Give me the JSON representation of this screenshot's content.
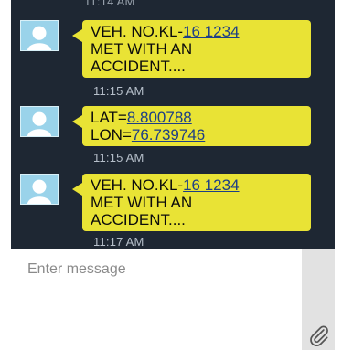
{
  "chat": {
    "top_time": "11:14 AM",
    "messages": [
      {
        "lines": [
          {
            "text": "VEH. NO.KL-",
            "link": "16 1234"
          },
          {
            "text": "MET WITH AN"
          },
          {
            "text": "ACCIDENT...."
          }
        ],
        "time": "11:15 AM"
      },
      {
        "lines": [
          {
            "text": "LAT=",
            "link": "8.800788"
          },
          {
            "text": "LON=",
            "link": "76.739746"
          }
        ],
        "time": "11:15 AM"
      },
      {
        "lines": [
          {
            "text": "VEH. NO.KL-",
            "link": "16 1234"
          },
          {
            "text": "MET WITH AN"
          },
          {
            "text": "ACCIDENT...."
          }
        ],
        "time": "11:17 AM"
      }
    ]
  },
  "composer": {
    "placeholder": "Enter message",
    "attach_icon": "paperclip-icon"
  },
  "colors": {
    "chat_background": "#1e2733",
    "bubble": "#e9e335",
    "avatar": "#9ad3ea",
    "link": "#1d3f86"
  }
}
